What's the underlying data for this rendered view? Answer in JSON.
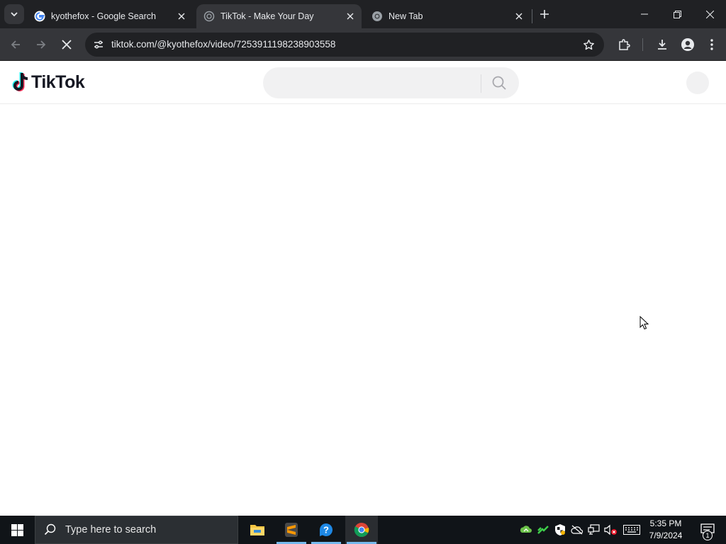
{
  "browser": {
    "tabs": [
      {
        "title": "kyothefox - Google Search",
        "favicon": "google-g-icon"
      },
      {
        "title": "TikTok - Make Your Day",
        "favicon": "tiktok-loading-icon",
        "active": true
      },
      {
        "title": "New Tab",
        "favicon": "chrome-icon"
      }
    ],
    "url": "tiktok.com/@kyothefox/video/7253911198238903558"
  },
  "page": {
    "logo_text": "TikTok",
    "search_placeholder": "",
    "accent": "#161823"
  },
  "taskbar": {
    "search_placeholder": "Type here to search",
    "apps": [
      "file-explorer-icon",
      "sublime-text-icon",
      "help-icon",
      "chrome-icon"
    ],
    "clock_time": "5:35 PM",
    "clock_date": "7/9/2024",
    "notification_count": "1"
  }
}
